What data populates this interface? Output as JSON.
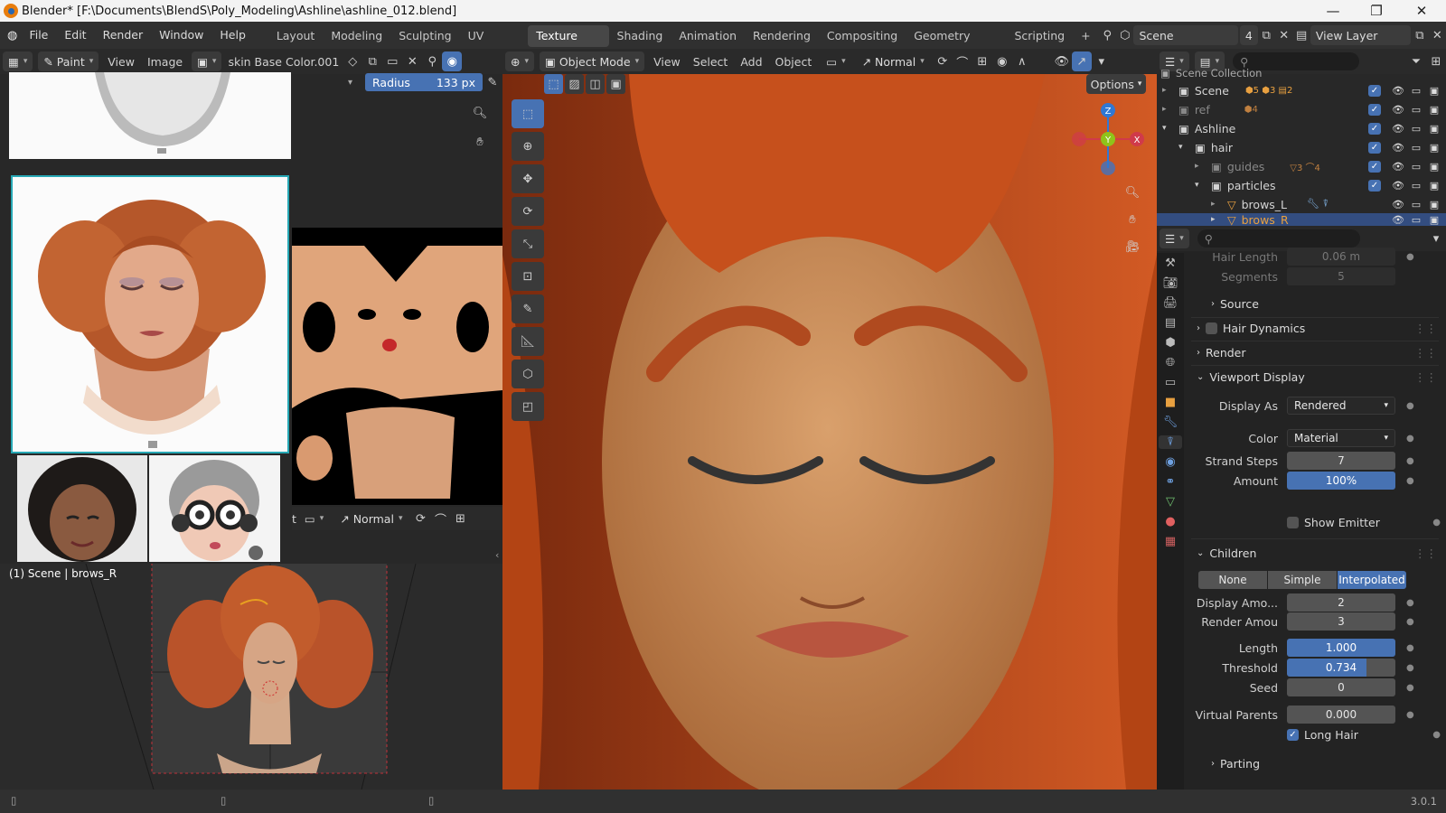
{
  "window": {
    "title": "Blender* [F:\\Documents\\BlendS\\Poly_Modeling\\Ashline\\ashline_012.blend]",
    "controls": [
      "—",
      "❐",
      "✕"
    ]
  },
  "menubar": {
    "menus": [
      "File",
      "Edit",
      "Render",
      "Window",
      "Help"
    ],
    "workspaces": [
      "Layout",
      "Modeling",
      "Sculpting",
      "UV Editing",
      "Texture Paint",
      "Shading",
      "Animation",
      "Rendering",
      "Compositing",
      "Geometry Nodes",
      "Scripting"
    ],
    "active_workspace": "Texture Paint",
    "add_tab": "+",
    "scene_name": "Scene",
    "scene_users": "4",
    "view_layer": "View Layer"
  },
  "image_editor": {
    "mode": "Paint",
    "menus": [
      "View",
      "Image"
    ],
    "image_name": "skin Base Color.001",
    "radius_label": "Radius",
    "radius_value": "133 px",
    "lower_header_mode": "Normal",
    "lower_header_partial": "t",
    "scene_label": "(1) Scene | brows_R"
  },
  "viewport": {
    "mode": "Object Mode",
    "menus": [
      "View",
      "Select",
      "Add",
      "Object"
    ],
    "shading_orientation": "Normal",
    "options_label": "Options",
    "gizmo": {
      "z": "Z",
      "y": "Y",
      "x": "X"
    }
  },
  "outliner": {
    "title": "Scene Collection",
    "search_placeholder": "",
    "rows": [
      {
        "name": "Scene",
        "indent": 0,
        "badges": [
          "5",
          "3",
          "2"
        ]
      },
      {
        "name": "ref",
        "indent": 0,
        "badges": [
          "4"
        ],
        "dim": true
      },
      {
        "name": "Ashline",
        "indent": 0,
        "badges": []
      },
      {
        "name": "hair",
        "indent": 1,
        "badges": []
      },
      {
        "name": "guides",
        "indent": 2,
        "badges": [
          "3",
          "4"
        ],
        "dim": true
      },
      {
        "name": "particles",
        "indent": 2,
        "badges": []
      },
      {
        "name": "brows_L",
        "indent": 3,
        "badges": []
      },
      {
        "name": "brows_R",
        "indent": 3,
        "badges": [],
        "selected": true
      }
    ]
  },
  "properties": {
    "hair_length_label": "Hair Length",
    "hair_length_value": "0.06 m",
    "segments_label": "Segments",
    "segments_value": "5",
    "source_label": "Source",
    "hair_dynamics_label": "Hair Dynamics",
    "render_label": "Render",
    "viewport_display_label": "Viewport Display",
    "display_as_label": "Display As",
    "display_as_value": "Rendered",
    "color_label": "Color",
    "color_value": "Material",
    "strand_steps_label": "Strand Steps",
    "strand_steps_value": "7",
    "amount_label": "Amount",
    "amount_value": "100%",
    "show_emitter_label": "Show Emitter",
    "children_label": "Children",
    "children_options": [
      "None",
      "Simple",
      "Interpolated"
    ],
    "children_active": "Interpolated",
    "display_amount_label": "Display Amo...",
    "display_amount_value": "2",
    "render_amount_label": "Render Amou",
    "render_amount_value": "3",
    "length_label": "Length",
    "length_value": "1.000",
    "threshold_label": "Threshold",
    "threshold_value": "0.734",
    "seed_label": "Seed",
    "seed_value": "0",
    "virtual_parents_label": "Virtual Parents",
    "virtual_parents_value": "0.000",
    "long_hair_label": "Long Hair",
    "long_hair_checked": true,
    "parting_label": "Parting"
  },
  "status": {
    "version": "3.0.1"
  },
  "colors": {
    "accent_blue": "#4772b3",
    "hair": "#c8541f",
    "skin": "#d99a68",
    "active_tab": "#474747"
  }
}
